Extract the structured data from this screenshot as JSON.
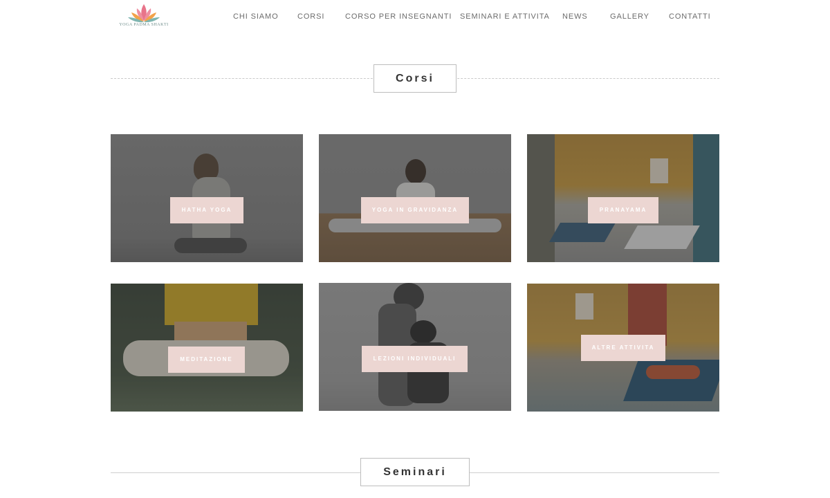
{
  "brand": {
    "logo_text": "YOGA PADMA SHAKTI"
  },
  "nav": {
    "items": [
      {
        "label": "CHI SIAMO"
      },
      {
        "label": "CORSI"
      },
      {
        "label": "CORSO PER INSEGNANTI"
      },
      {
        "label": "SEMINARI E ATTIVITA"
      },
      {
        "label": "NEWS"
      },
      {
        "label": "GALLERY"
      },
      {
        "label": "CONTATTI"
      }
    ]
  },
  "sections": {
    "corsi_title": "Corsi",
    "seminari_title": "Seminari"
  },
  "tiles": [
    {
      "label": "HATHA YOGA"
    },
    {
      "label": "YOGA IN GRAVIDANZA"
    },
    {
      "label": "PRANAYAMA"
    },
    {
      "label": "MEDITAZIONE"
    },
    {
      "label": "LEZIONI INDIVIDUALI"
    },
    {
      "label": "ALTRE ATTIVITA"
    }
  ],
  "colors": {
    "button_bg": "#ecd6d2",
    "nav_text": "#6b6b6b",
    "lotus_pink": "#e07a8a",
    "lotus_orange": "#f0a040"
  }
}
